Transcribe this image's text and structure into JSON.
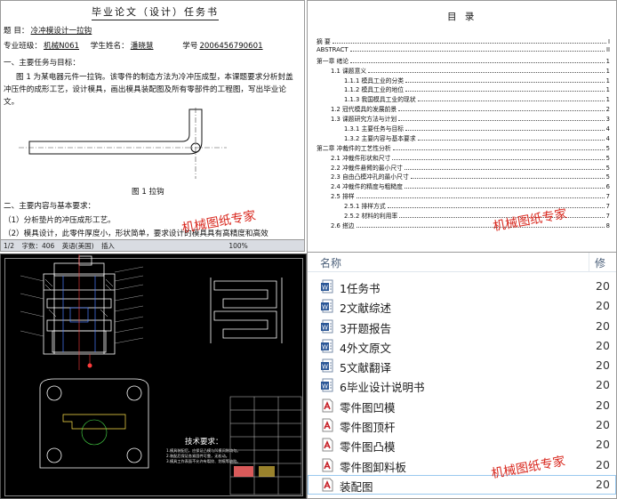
{
  "document": {
    "title": "毕业论文（设计）任务书",
    "topic_label": "题        目：",
    "topic_value": "冷冲模设计一拉钩",
    "class_label": "专业班级：",
    "class_value": "机械N061",
    "student_label": "学生姓名：",
    "student_value": "潘晓慧",
    "id_label": "学号",
    "id_value": "2006456790601",
    "section1": "一、主要任务与目标：",
    "para1": "图 1 为某电器元件一拉钩。该零件的制造方法为冷冲压成型，本课题要求分析封盖冲压件的成形工艺，设计模具，画出模具装配图及所有零部件的工程图，写出毕业论文。",
    "figure_caption": "图 1  拉钩",
    "section2": "二、主要内容与基本要求：",
    "item1": "（1）分析垫片的冲压成形工艺。",
    "item2": "（2）模具设计，此零件厚度小，形状简单，要求设计的模具具有高精度和高效",
    "status": {
      "page": "1/2",
      "words": "字数：406",
      "lang": "英语(美国)",
      "mode": "插入",
      "zoom": "100%"
    }
  },
  "toc": {
    "title": "目 录",
    "rows": [
      {
        "t": "摘  要",
        "pg": "I",
        "lvl": 1
      },
      {
        "t": "ABSTRACT",
        "pg": "II",
        "lvl": 1
      },
      {
        "t": "第一章  绪论",
        "pg": "1",
        "lvl": 1
      },
      {
        "t": "1.1  课题意义",
        "pg": "1",
        "lvl": 2
      },
      {
        "t": "1.1.1  模具工业的分类",
        "pg": "1",
        "lvl": 3
      },
      {
        "t": "1.1.2  模具工业的地位",
        "pg": "1",
        "lvl": 3
      },
      {
        "t": "1.1.3  我国模具工业的现状",
        "pg": "1",
        "lvl": 3
      },
      {
        "t": "1.2  冠代模具的发展前景",
        "pg": "2",
        "lvl": 2
      },
      {
        "t": "1.3  课题研究方法与计划",
        "pg": "3",
        "lvl": 2
      },
      {
        "t": "1.3.1  主要任务与目标",
        "pg": "4",
        "lvl": 3
      },
      {
        "t": "1.3.2  主要内容与基本要求",
        "pg": "4",
        "lvl": 3
      },
      {
        "t": "第二章  冲裁件的工艺性分析",
        "pg": "5",
        "lvl": 1
      },
      {
        "t": "2.1  冲裁件形状和尺寸",
        "pg": "5",
        "lvl": 2
      },
      {
        "t": "2.2  冲裁件悬臂的最小尺寸",
        "pg": "5",
        "lvl": 2
      },
      {
        "t": "2.3  自由凸模冲孔的最小尺寸",
        "pg": "5",
        "lvl": 2
      },
      {
        "t": "2.4  冲裁件的精度与粗糙度",
        "pg": "6",
        "lvl": 2
      },
      {
        "t": "2.5  排样",
        "pg": "7",
        "lvl": 2
      },
      {
        "t": "2.5.1  排样方式",
        "pg": "7",
        "lvl": 3
      },
      {
        "t": "2.5.2  材料的利用率",
        "pg": "7",
        "lvl": 3
      },
      {
        "t": "2.6  搭边",
        "pg": "8",
        "lvl": 2
      }
    ]
  },
  "cad": {
    "tech_title": "技术要求：",
    "notes": [
      "1.模具装配后，应保证凸模与凹模间隙均匀。",
      "2.装配后保证各紧固件可靠，无松动。",
      "3.模具工作表面不允许有裂纹、划痕等缺陷。"
    ]
  },
  "files": {
    "col_name": "名称",
    "col_date": "修",
    "rows": [
      {
        "name": "1任务书",
        "date": "20",
        "icon": "word-doc-icon"
      },
      {
        "name": "2文献综述",
        "date": "20",
        "icon": "word-doc-icon"
      },
      {
        "name": "3开题报告",
        "date": "20",
        "icon": "word-doc-icon"
      },
      {
        "name": "4外文原文",
        "date": "20",
        "icon": "word-doc-icon"
      },
      {
        "name": "5文献翻译",
        "date": "20",
        "icon": "word-doc-icon"
      },
      {
        "name": "6毕业设计说明书",
        "date": "20",
        "icon": "word-doc-icon"
      },
      {
        "name": "零件图凹模",
        "date": "20",
        "icon": "cad-file-icon"
      },
      {
        "name": "零件图顶杆",
        "date": "20",
        "icon": "cad-file-icon"
      },
      {
        "name": "零件图凸模",
        "date": "20",
        "icon": "cad-file-icon"
      },
      {
        "name": "零件图卸料板",
        "date": "20",
        "icon": "cad-file-icon"
      },
      {
        "name": "装配图",
        "date": "20",
        "icon": "cad-file-icon"
      }
    ]
  },
  "watermark": "机械图纸专家"
}
